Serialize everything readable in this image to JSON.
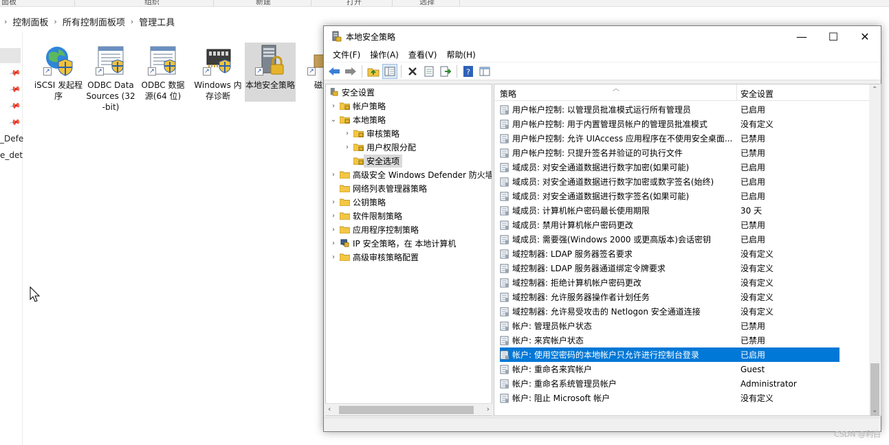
{
  "explorer": {
    "ribbon": {
      "groups": [
        "面板",
        "组织",
        "新建",
        "打开",
        "选择"
      ]
    },
    "breadcrumb": [
      "控制面板",
      "所有控制面板项",
      "管理工具"
    ],
    "nav": {
      "partial_labels": [
        "_Defe",
        "e_det"
      ]
    },
    "items": [
      {
        "label": "iSCSI 发起程序",
        "icon": "globe-shield-icon"
      },
      {
        "label": "ODBC Data Sources (32-bit)",
        "icon": "odbc-window-icon"
      },
      {
        "label": "ODBC 数据源(64 位)",
        "icon": "odbc-window-icon"
      },
      {
        "label": "Windows 内存诊断",
        "icon": "memory-chip-icon"
      },
      {
        "label": "本地安全策略",
        "icon": "server-lock-icon"
      },
      {
        "label": "磁盘",
        "icon": "disk-icon"
      }
    ],
    "selected_item": "本地安全策略"
  },
  "lsp": {
    "title": "本地安全策略",
    "window_buttons": {
      "minimize": "—",
      "maximize": "☐",
      "close": "✕"
    },
    "menu": [
      "文件(F)",
      "操作(A)",
      "查看(V)",
      "帮助(H)"
    ],
    "toolbar": [
      "back-icon",
      "forward-icon",
      "up-folder-icon",
      "show-tree-icon",
      "delete-icon",
      "properties-icon",
      "export-icon",
      "help-icon",
      "view-icon"
    ],
    "tree": [
      {
        "label": "安全设置",
        "depth": 0,
        "arrow": "",
        "icon": "security-root"
      },
      {
        "label": "帐户策略",
        "depth": 1,
        "arrow": "›",
        "icon": "folder"
      },
      {
        "label": "本地策略",
        "depth": 1,
        "arrow": "⌄",
        "icon": "folder"
      },
      {
        "label": "审核策略",
        "depth": 2,
        "arrow": "›",
        "icon": "folder"
      },
      {
        "label": "用户权限分配",
        "depth": 2,
        "arrow": "›",
        "icon": "folder"
      },
      {
        "label": "安全选项",
        "depth": 2,
        "arrow": "",
        "icon": "folder",
        "selected": true
      },
      {
        "label": "高级安全 Windows Defender 防火墙",
        "depth": 1,
        "arrow": "›",
        "icon": "folder"
      },
      {
        "label": "网络列表管理器策略",
        "depth": 1,
        "arrow": "",
        "icon": "folder"
      },
      {
        "label": "公钥策略",
        "depth": 1,
        "arrow": "›",
        "icon": "folder"
      },
      {
        "label": "软件限制策略",
        "depth": 1,
        "arrow": "›",
        "icon": "folder"
      },
      {
        "label": "应用程序控制策略",
        "depth": 1,
        "arrow": "›",
        "icon": "folder"
      },
      {
        "label": "IP 安全策略，在 本地计算机",
        "depth": 1,
        "arrow": "›",
        "icon": "ip-security"
      },
      {
        "label": "高级审核策略配置",
        "depth": 1,
        "arrow": "›",
        "icon": "folder"
      }
    ],
    "list": {
      "headers": {
        "policy": "策略",
        "setting": "安全设置"
      },
      "rows": [
        {
          "policy": "用户帐户控制: 以管理员批准模式运行所有管理员",
          "setting": "已启用"
        },
        {
          "policy": "用户帐户控制: 用于内置管理员帐户的管理员批准模式",
          "setting": "没有定义"
        },
        {
          "policy": "用户帐户控制: 允许 UIAccess 应用程序在不使用安全桌面...",
          "setting": "已禁用"
        },
        {
          "policy": "用户帐户控制: 只提升签名并验证的可执行文件",
          "setting": "已禁用"
        },
        {
          "policy": "域成员: 对安全通道数据进行数字加密(如果可能)",
          "setting": "已启用"
        },
        {
          "policy": "域成员: 对安全通道数据进行数字加密或数字签名(始终)",
          "setting": "已启用"
        },
        {
          "policy": "域成员: 对安全通道数据进行数字签名(如果可能)",
          "setting": "已启用"
        },
        {
          "policy": "域成员: 计算机帐户密码最长使用期限",
          "setting": "30 天"
        },
        {
          "policy": "域成员: 禁用计算机帐户密码更改",
          "setting": "已禁用"
        },
        {
          "policy": "域成员: 需要强(Windows 2000 或更高版本)会话密钥",
          "setting": "已启用"
        },
        {
          "policy": "域控制器: LDAP 服务器签名要求",
          "setting": "没有定义"
        },
        {
          "policy": "域控制器: LDAP 服务器通道绑定令牌要求",
          "setting": "没有定义"
        },
        {
          "policy": "域控制器: 拒绝计算机帐户密码更改",
          "setting": "没有定义"
        },
        {
          "policy": "域控制器: 允许服务器操作者计划任务",
          "setting": "没有定义"
        },
        {
          "policy": "域控制器: 允许易受攻击的 Netlogon 安全通道连接",
          "setting": "没有定义"
        },
        {
          "policy": "帐户: 管理员帐户状态",
          "setting": "已禁用"
        },
        {
          "policy": "帐户: 来宾帐户状态",
          "setting": "已禁用"
        },
        {
          "policy": "帐户: 使用空密码的本地帐户只允许进行控制台登录",
          "setting": "已启用",
          "selected": true
        },
        {
          "policy": "帐户: 重命名来宾帐户",
          "setting": "Guest"
        },
        {
          "policy": "帐户: 重命名系统管理员帐户",
          "setting": "Administrator"
        },
        {
          "policy": "帐户: 阻止 Microsoft 帐户",
          "setting": "没有定义"
        }
      ]
    },
    "tree_scroll": {
      "left": "‹",
      "right": "›"
    },
    "list_scroll": {
      "up": "⌃",
      "down": "⌄"
    }
  },
  "watermark": "CSDN @利白",
  "colors": {
    "selection": "#0078d7",
    "folder": "#f3c644"
  }
}
